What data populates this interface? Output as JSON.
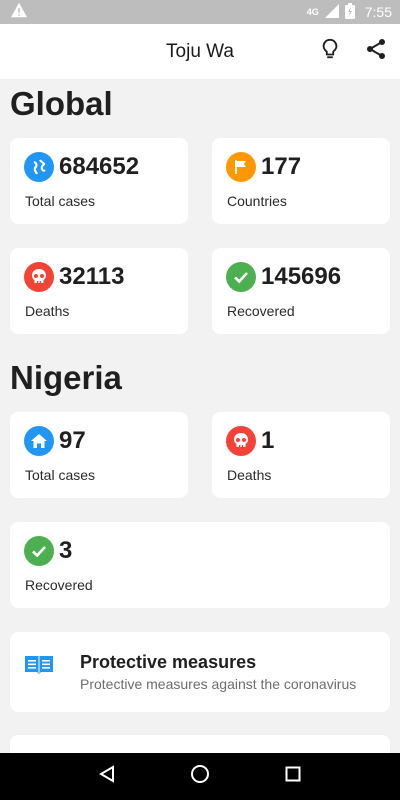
{
  "status_bar": {
    "time": "7:55",
    "network": "4G"
  },
  "app_bar": {
    "title": "Toju Wa",
    "actions": [
      "lightbulb-icon",
      "share-icon"
    ]
  },
  "global": {
    "title": "Global",
    "stats": [
      {
        "value": "684652",
        "label": "Total cases",
        "icon": "globe-icon",
        "color": "#2196f3"
      },
      {
        "value": "177",
        "label": "Countries",
        "icon": "flag-icon",
        "color": "#ff9800"
      },
      {
        "value": "32113",
        "label": "Deaths",
        "icon": "skull-icon",
        "color": "#f44336"
      },
      {
        "value": "145696",
        "label": "Recovered",
        "icon": "check-icon",
        "color": "#4caf50"
      }
    ]
  },
  "nigeria": {
    "title": "Nigeria",
    "stats": [
      {
        "value": "97",
        "label": "Total cases",
        "icon": "home-icon",
        "color": "#2196f3"
      },
      {
        "value": "1",
        "label": "Deaths",
        "icon": "skull-icon",
        "color": "#f44336"
      },
      {
        "value": "3",
        "label": "Recovered",
        "icon": "check-icon",
        "color": "#4caf50"
      }
    ]
  },
  "measures": {
    "title": "Protective measures",
    "subtitle": "Protective measures against the coronavirus",
    "icon": "book-icon",
    "color": "#2196f3"
  }
}
